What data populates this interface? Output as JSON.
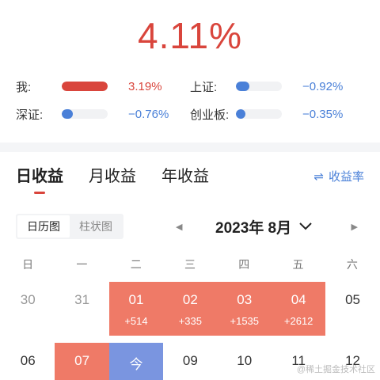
{
  "headline": "4.11%",
  "compare": [
    {
      "label": "我:",
      "value": "3.19%",
      "fill": 1.0,
      "tone": "red"
    },
    {
      "label": "上证:",
      "value": "−0.92%",
      "fill": 0.29,
      "tone": "blue"
    },
    {
      "label": "深证:",
      "value": "−0.76%",
      "fill": 0.24,
      "tone": "blue"
    },
    {
      "label": "创业板:",
      "value": "−0.35%",
      "fill": 0.11,
      "tone": "blue"
    }
  ],
  "colors": {
    "gain": "#ef7a67",
    "loss": "#4a80d8",
    "today": "#7a95e0",
    "accent": "#d9453c"
  },
  "tabs": [
    {
      "label": "日收益",
      "active": true
    },
    {
      "label": "月收益",
      "active": false
    },
    {
      "label": "年收益",
      "active": false
    }
  ],
  "toggle": {
    "icon": "swap-arrows-icon",
    "label": "收益率"
  },
  "view_switch": {
    "options": [
      "日历图",
      "柱状图"
    ],
    "selected": "日历图"
  },
  "month_nav": {
    "month": "2023年 8月",
    "prev_icon": "triangle-left-icon",
    "next_icon": "triangle-right-icon",
    "dropdown_icon": "chevron-down-icon"
  },
  "weekdays": [
    "日",
    "一",
    "二",
    "三",
    "四",
    "五",
    "六"
  ],
  "calendar": {
    "rows": [
      [
        {
          "day": "30",
          "other": true
        },
        {
          "day": "31",
          "other": true
        },
        {
          "day": "01",
          "pnl": "+514",
          "state": "gain"
        },
        {
          "day": "02",
          "pnl": "+335",
          "state": "gain"
        },
        {
          "day": "03",
          "pnl": "+1535",
          "state": "gain"
        },
        {
          "day": "04",
          "pnl": "+2612",
          "state": "gain"
        },
        {
          "day": "05"
        }
      ],
      [
        {
          "day": "06"
        },
        {
          "day": "07",
          "state": "gain"
        },
        {
          "day": "今",
          "state": "today"
        },
        {
          "day": "09"
        },
        {
          "day": "10"
        },
        {
          "day": "11"
        },
        {
          "day": "12"
        }
      ]
    ]
  },
  "watermark": "@稀土掘金技术社区"
}
